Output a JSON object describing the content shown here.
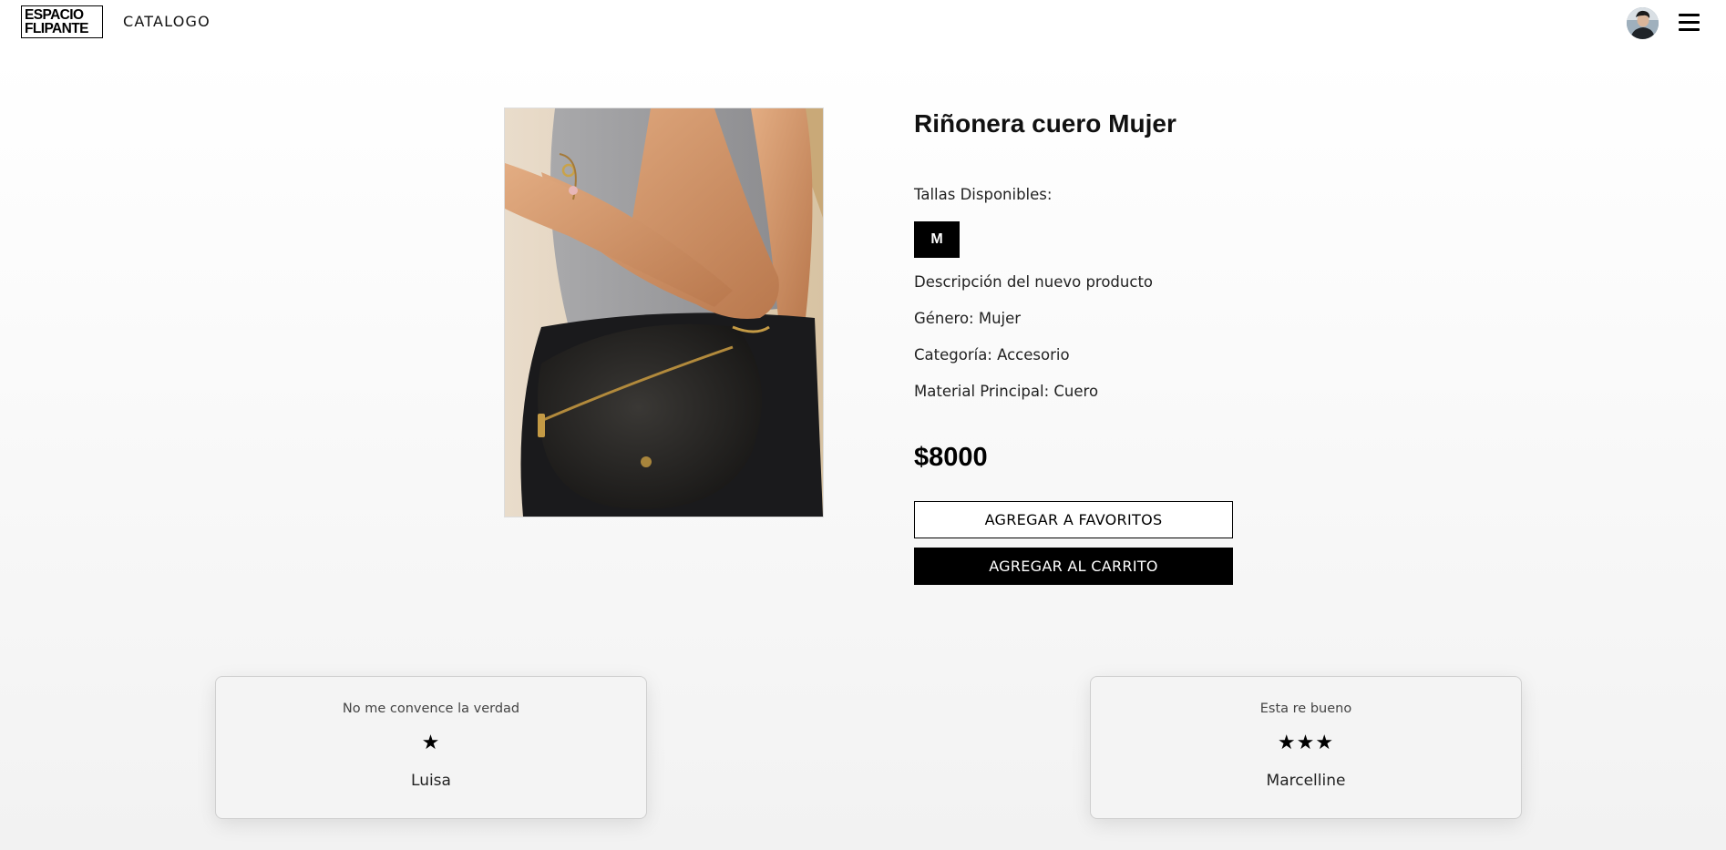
{
  "header": {
    "logo_line1": "ESPACIO",
    "logo_line2": "FLIPANTE",
    "nav_catalog": "CATALOGO",
    "avatar_icon": "user-avatar",
    "menu_icon": "hamburger-menu-icon"
  },
  "product": {
    "image_icon": "leather-fanny-pack-photo",
    "title": "Riñonera cuero Mujer",
    "sizes_label": "Tallas Disponibles:",
    "sizes": [
      "M"
    ],
    "description": "Descripción del nuevo producto",
    "gender": "Género: Mujer",
    "category": "Categoría: Accesorio",
    "material": "Material Principal: Cuero",
    "price": "$8000",
    "favorites_button": "AGREGAR A FAVORITOS",
    "cart_button": "AGREGAR AL CARRITO"
  },
  "reviews": [
    {
      "text": "No me convence la verdad",
      "stars": "★",
      "rating": 1,
      "author": "Luisa"
    },
    {
      "text": "Esta re bueno",
      "stars": "★★★",
      "rating": 3,
      "author": "Marcelline"
    }
  ],
  "colors": {
    "primary": "#000000",
    "background": "#f5f5f5",
    "text": "#111111"
  }
}
